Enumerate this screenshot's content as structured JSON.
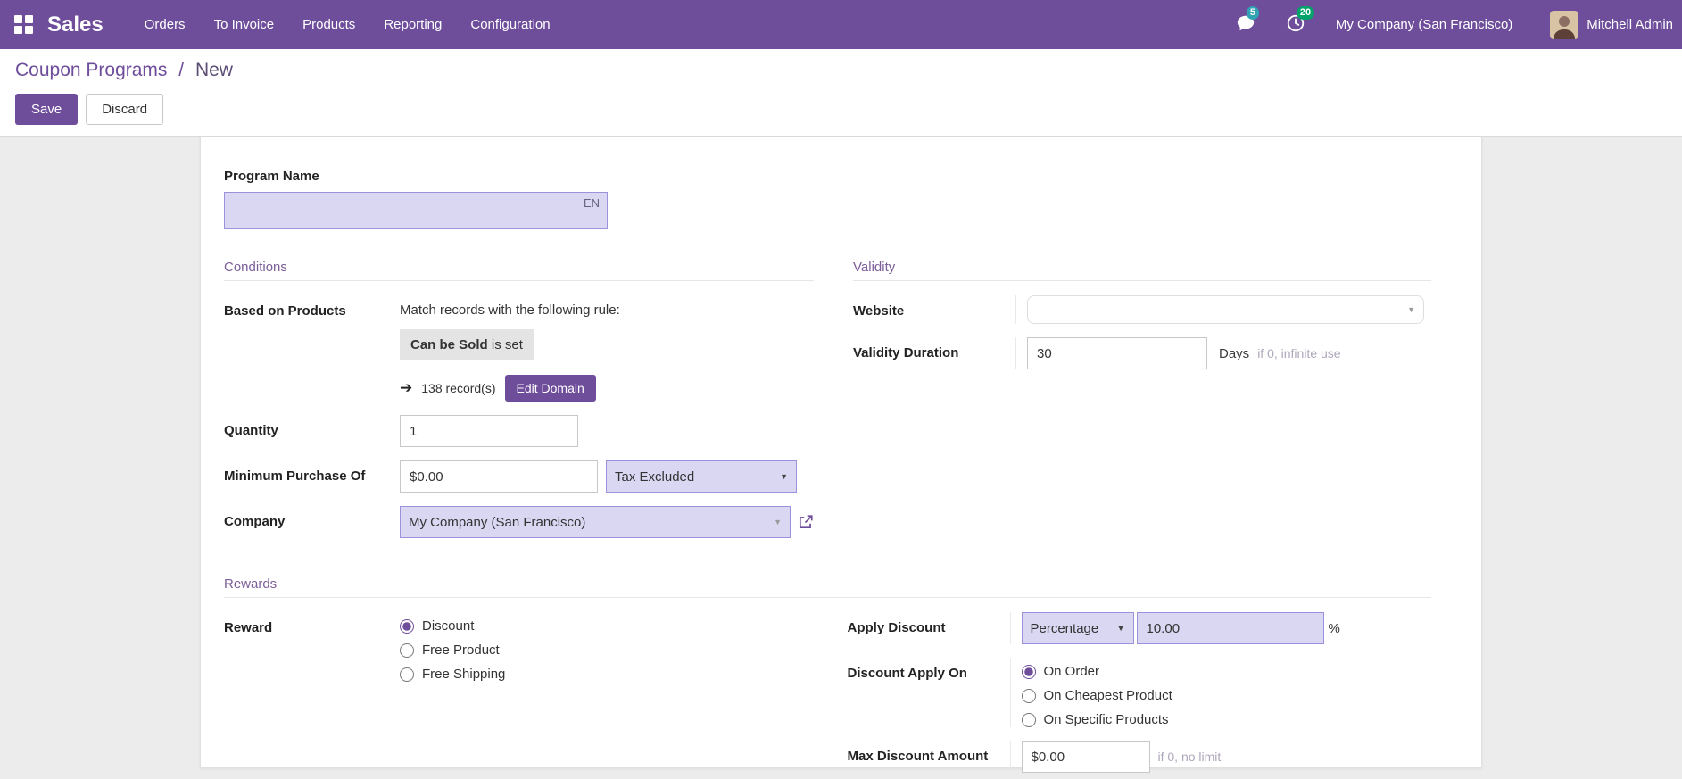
{
  "colors": {
    "primary": "#6e4d9b",
    "nav_bg": "#6e4d9b",
    "field_highlight_bg": "#dad7f3",
    "field_highlight_border": "#9a92dd",
    "messages_badge_bg": "#31a3b4",
    "activities_badge_bg": "#00a36a"
  },
  "nav": {
    "app_name": "Sales",
    "items": [
      {
        "label": "Orders"
      },
      {
        "label": "To Invoice"
      },
      {
        "label": "Products"
      },
      {
        "label": "Reporting"
      },
      {
        "label": "Configuration"
      }
    ],
    "messages_badge": "5",
    "activities_badge": "20",
    "company": "My Company (San Francisco)",
    "user": "Mitchell Admin"
  },
  "breadcrumb": {
    "parent": "Coupon Programs",
    "separator": "/",
    "current": "New"
  },
  "actions": {
    "save": "Save",
    "discard": "Discard"
  },
  "form": {
    "program_name": {
      "label": "Program Name",
      "value": "",
      "lang": "EN"
    },
    "conditions": {
      "title": "Conditions",
      "based_on_products": {
        "label": "Based on Products",
        "hint": "Match records with the following rule:",
        "rule_field": "Can be Sold",
        "rule_operator": "is set",
        "records_count": "138 record(s)",
        "edit_domain": "Edit Domain"
      },
      "quantity": {
        "label": "Quantity",
        "value": "1"
      },
      "min_purchase": {
        "label": "Minimum Purchase Of",
        "value": "$0.00",
        "tax_mode": "Tax Excluded"
      },
      "company": {
        "label": "Company",
        "value": "My Company (San Francisco)"
      }
    },
    "validity": {
      "title": "Validity",
      "website": {
        "label": "Website",
        "value": ""
      },
      "duration": {
        "label": "Validity Duration",
        "value": "30",
        "unit": "Days",
        "hint": "if 0, infinite use"
      }
    },
    "rewards": {
      "title": "Rewards",
      "reward": {
        "label": "Reward",
        "options": [
          "Discount",
          "Free Product",
          "Free Shipping"
        ],
        "selected": "Discount"
      },
      "apply_discount": {
        "label": "Apply Discount",
        "mode": "Percentage",
        "value": "10.00",
        "suffix": "%"
      },
      "discount_apply_on": {
        "label": "Discount Apply On",
        "options": [
          "On Order",
          "On Cheapest Product",
          "On Specific Products"
        ],
        "selected": "On Order"
      },
      "max_discount": {
        "label": "Max Discount Amount",
        "value": "$0.00",
        "hint": "if 0, no limit"
      }
    }
  }
}
